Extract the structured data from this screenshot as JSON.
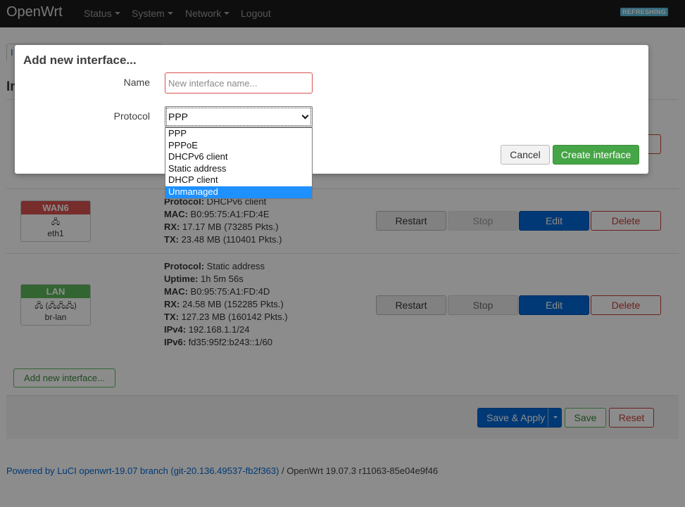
{
  "brand": "OpenWrt",
  "nav": [
    {
      "label": "Status",
      "has_menu": true
    },
    {
      "label": "System",
      "has_menu": true
    },
    {
      "label": "Network",
      "has_menu": true
    },
    {
      "label": "Logout",
      "has_menu": false
    }
  ],
  "refresh_badge": "REFRESHING",
  "page": {
    "tab_label": "I",
    "heading": "In"
  },
  "interfaces": [
    {
      "name": "WAN6",
      "color": "#f0a8a8",
      "device": "eth1",
      "icons": "🖧",
      "info": [
        {
          "k": "Protocol:",
          "v": " DHCPv6 client"
        },
        {
          "k": "MAC:",
          "v": " B0:95:75:A1:FD:4E"
        },
        {
          "k": "RX:",
          "v": " 17.17 MB (73285 Pkts.)"
        },
        {
          "k": "TX:",
          "v": " 23.48 MB (110401 Pkts.)"
        }
      ],
      "buttons": {
        "restart": "Restart",
        "stop": "Stop",
        "edit": "Edit",
        "delete": "Delete"
      },
      "stop_disabled": true
    },
    {
      "name": "LAN",
      "color": "#90d490",
      "device": "br-lan",
      "icons": "🖧 (🖧🖧🖧)",
      "info": [
        {
          "k": "Protocol:",
          "v": " Static address"
        },
        {
          "k": "Uptime:",
          "v": " 1h 5m 56s"
        },
        {
          "k": "MAC:",
          "v": " B0:95:75:A1:FD:4D"
        },
        {
          "k": "RX:",
          "v": " 24.58 MB (152285 Pkts.)"
        },
        {
          "k": "TX:",
          "v": " 127.23 MB (160142 Pkts.)"
        },
        {
          "k": "IPv4:",
          "v": " 192.168.1.1/24"
        },
        {
          "k": "IPv6:",
          "v": " fd35:95f2:b243::1/60"
        }
      ],
      "buttons": {
        "restart": "Restart",
        "stop": "Stop",
        "edit": "Edit",
        "delete": "Delete"
      },
      "stop_disabled": false
    }
  ],
  "add_interface_label": "Add new interface...",
  "actions": {
    "save_apply": "Save & Apply",
    "save": "Save",
    "reset": "Reset"
  },
  "footer": {
    "link": "Powered by LuCI openwrt-19.07 branch (git-20.136.49537-fb2f363)",
    "rest": " / OpenWrt 19.07.3 r11063-85e04e9f46"
  },
  "modal": {
    "title": "Add new interface...",
    "name_label": "Name",
    "name_value": "",
    "name_placeholder": "New interface name...",
    "protocol_label": "Protocol",
    "protocol_selected": "PPP",
    "protocol_options": [
      "PPP",
      "PPPoE",
      "DHCPv6 client",
      "Static address",
      "DHCP client",
      "Unmanaged"
    ],
    "highlighted_option": "Unmanaged",
    "cancel": "Cancel",
    "create": "Create interface"
  }
}
